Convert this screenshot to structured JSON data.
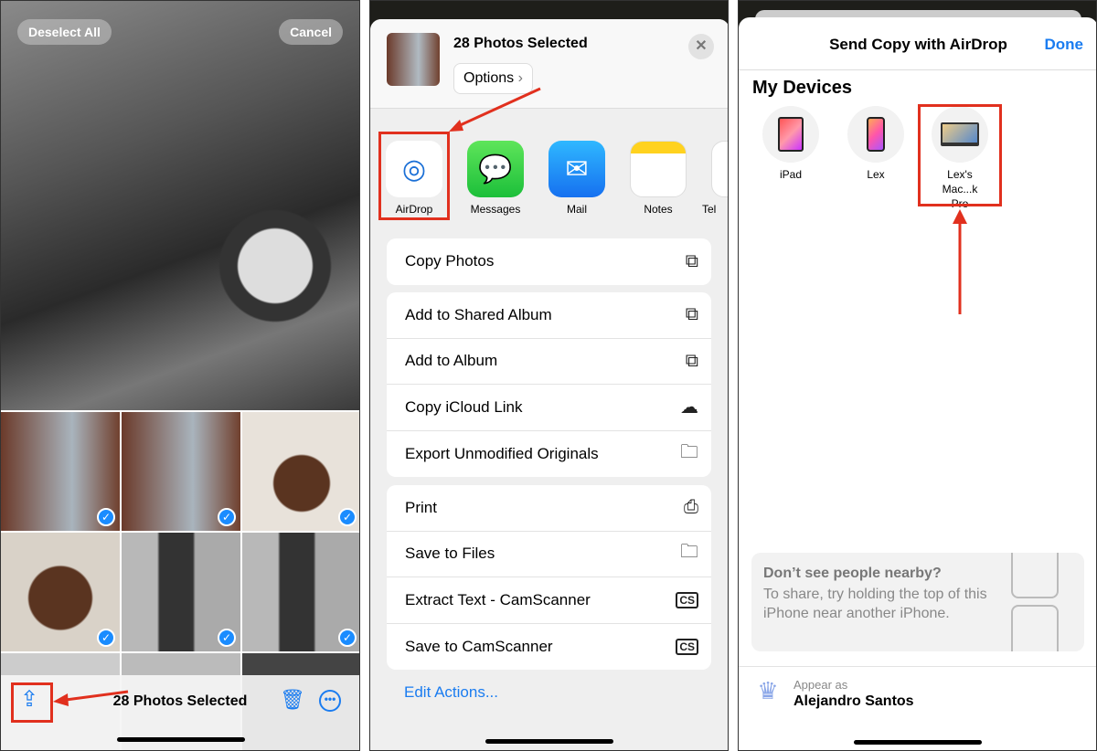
{
  "panel1": {
    "deselect_all": "Deselect All",
    "cancel": "Cancel",
    "toolbar_title": "28 Photos Selected",
    "icons": [
      "share-icon",
      "trash-icon",
      "more-icon"
    ]
  },
  "panel2": {
    "title": "28 Photos Selected",
    "options": "Options",
    "apps": [
      {
        "label": "AirDrop"
      },
      {
        "label": "Messages"
      },
      {
        "label": "Mail"
      },
      {
        "label": "Notes"
      },
      {
        "label": "Tel"
      }
    ],
    "group1": [
      {
        "label": "Copy Photos",
        "icon": "copy-icon"
      }
    ],
    "group2": [
      {
        "label": "Add to Shared Album",
        "icon": "shared-album-icon"
      },
      {
        "label": "Add to Album",
        "icon": "add-album-icon"
      },
      {
        "label": "Copy iCloud Link",
        "icon": "link-cloud-icon"
      },
      {
        "label": "Export Unmodified Originals",
        "icon": "folder-icon"
      }
    ],
    "group3": [
      {
        "label": "Print",
        "icon": "printer-icon"
      },
      {
        "label": "Save to Files",
        "icon": "folder-icon"
      },
      {
        "label": "Extract Text - CamScanner",
        "icon": "camscanner-text-icon"
      },
      {
        "label": "Save to CamScanner",
        "icon": "camscanner-icon"
      }
    ],
    "edit_actions": "Edit Actions..."
  },
  "panel3": {
    "title": "Send Copy with AirDrop",
    "done": "Done",
    "section": "My Devices",
    "devices": [
      {
        "label": "iPad"
      },
      {
        "label": "Lex"
      },
      {
        "label": "Lex's Mac...k Pro"
      }
    ],
    "hint_title": "Don’t see people nearby?",
    "hint_body": "To share, try holding the top of this iPhone near another iPhone.",
    "appear_as": "Appear as",
    "name": "Alejandro Santos"
  },
  "colors": {
    "accent": "#1a7cf0",
    "highlight": "#e1301e"
  }
}
